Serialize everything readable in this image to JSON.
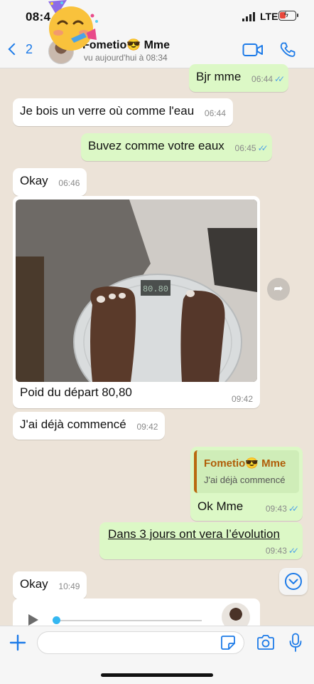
{
  "status_bar": {
    "time": "08:4",
    "carrier": "LTE"
  },
  "header": {
    "back_count": "2",
    "contact_name": "Fometio😎 Mme",
    "contact_status": "vu aujourd'hui à 08:34"
  },
  "messages": [
    {
      "direction": "out",
      "text": "Bjr mme",
      "time": "06:44",
      "read": true
    },
    {
      "direction": "in",
      "text": "Je bois un verre où comme l'eau",
      "time": "06:44"
    },
    {
      "direction": "out",
      "text": "Buvez comme votre eaux",
      "time": "06:45",
      "read": true
    },
    {
      "direction": "in",
      "text": "Okay",
      "time": "06:46"
    },
    {
      "direction": "in",
      "type": "image",
      "caption": "Poid du départ 80,80",
      "time": "09:42",
      "scale_display": "80.80"
    },
    {
      "direction": "in",
      "text": "J'ai déjà commencé",
      "time": "09:42"
    },
    {
      "direction": "out",
      "type": "reply",
      "quoted_name": "Fometio😎 Mme",
      "quoted_text": "J'ai déjà commencé",
      "text": "Ok Mme",
      "time": "09:43",
      "read": true
    },
    {
      "direction": "out",
      "type": "link",
      "text": "Dans 3 jours ont vera l’évolution",
      "time": "09:43",
      "read": true
    },
    {
      "direction": "in",
      "text": "Okay",
      "time": "10:49"
    },
    {
      "direction": "in",
      "type": "voice"
    }
  ],
  "icons": {
    "status": [
      "signal-icon",
      "battery-icon",
      "party-emoji-icon"
    ],
    "header": [
      "back-chevron-icon",
      "video-call-icon",
      "phone-call-icon"
    ],
    "chat": [
      "forward-icon",
      "scroll-down-icon",
      "play-icon"
    ],
    "input": [
      "plus-icon",
      "sticker-icon",
      "camera-icon",
      "mic-icon"
    ]
  },
  "colors": {
    "accent": "#1d7be8",
    "chat_background": "#ece3d8",
    "outgoing_bubble": "#dcf8c6",
    "incoming_bubble": "#ffffff",
    "read_tick": "#4fa3e8",
    "quote_name": "#b05d08",
    "battery_low": "#e8473b"
  }
}
